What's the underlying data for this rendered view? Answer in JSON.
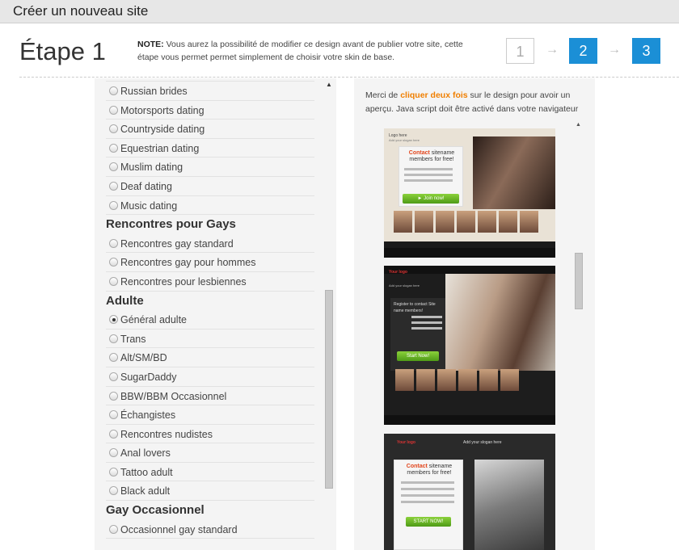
{
  "window": {
    "title": "Créer un nouveau site"
  },
  "header": {
    "step_title": "Étape 1",
    "note_label": "NOTE:",
    "note_text": " Vous aurez la possibilité de modifier ce design avant de publier votre site, cette étape vous permet permet simplement de choisir votre skin de base."
  },
  "steps": [
    {
      "number": "1",
      "state": "inactive"
    },
    {
      "number": "2",
      "state": "active"
    },
    {
      "number": "3",
      "state": "active"
    }
  ],
  "step_arrow": "→",
  "categories": {
    "top_items": [
      "Russian brides",
      "Motorsports dating",
      "Countryside dating",
      "Equestrian dating",
      "Muslim dating",
      "Deaf dating",
      "Music dating"
    ],
    "gays_title": "Rencontres pour Gays",
    "gays_items": [
      "Rencontres gay standard",
      "Rencontres gay pour hommes",
      "Rencontres pour lesbiennes"
    ],
    "adult_title": "Adulte",
    "adult_items": [
      "Général adulte",
      "Trans",
      "Alt/SM/BD",
      "SugarDaddy",
      "BBW/BBM Occasionnel",
      "Échangistes",
      "Rencontres nudistes",
      "Anal lovers",
      "Tattoo adult",
      "Black adult"
    ],
    "occasional_title": "Gay Occasionnel",
    "occasional_items": [
      "Occasionnel gay standard"
    ],
    "selected": "Général adulte"
  },
  "preview": {
    "hint_before": "Merci de ",
    "hint_accent": "cliquer deux fois",
    "hint_after": " sur le design pour avoir un aperçu. Java script doit être activé dans votre navigateur",
    "accent_color": "#f07f00",
    "skin1": {
      "logo": "Logo here",
      "slogan": "Add your slogan here",
      "contact_accent": "Contact",
      "contact_rest": " sitename members for free!",
      "join": "► Join now!"
    },
    "skin2": {
      "logo": "Your logo",
      "slogan": "Add your slogan here",
      "register": "Register to contact Site name members!",
      "start": "Start Now!"
    },
    "skin3": {
      "logo": "Your logo",
      "slogan": "Add your slogan here",
      "contact_accent": "Contact",
      "contact_rest": " sitename members for free!",
      "start": "START NOW!"
    }
  },
  "colors": {
    "step_active": "#1b8fd6",
    "titlebar_bg": "#e7e7e7"
  }
}
